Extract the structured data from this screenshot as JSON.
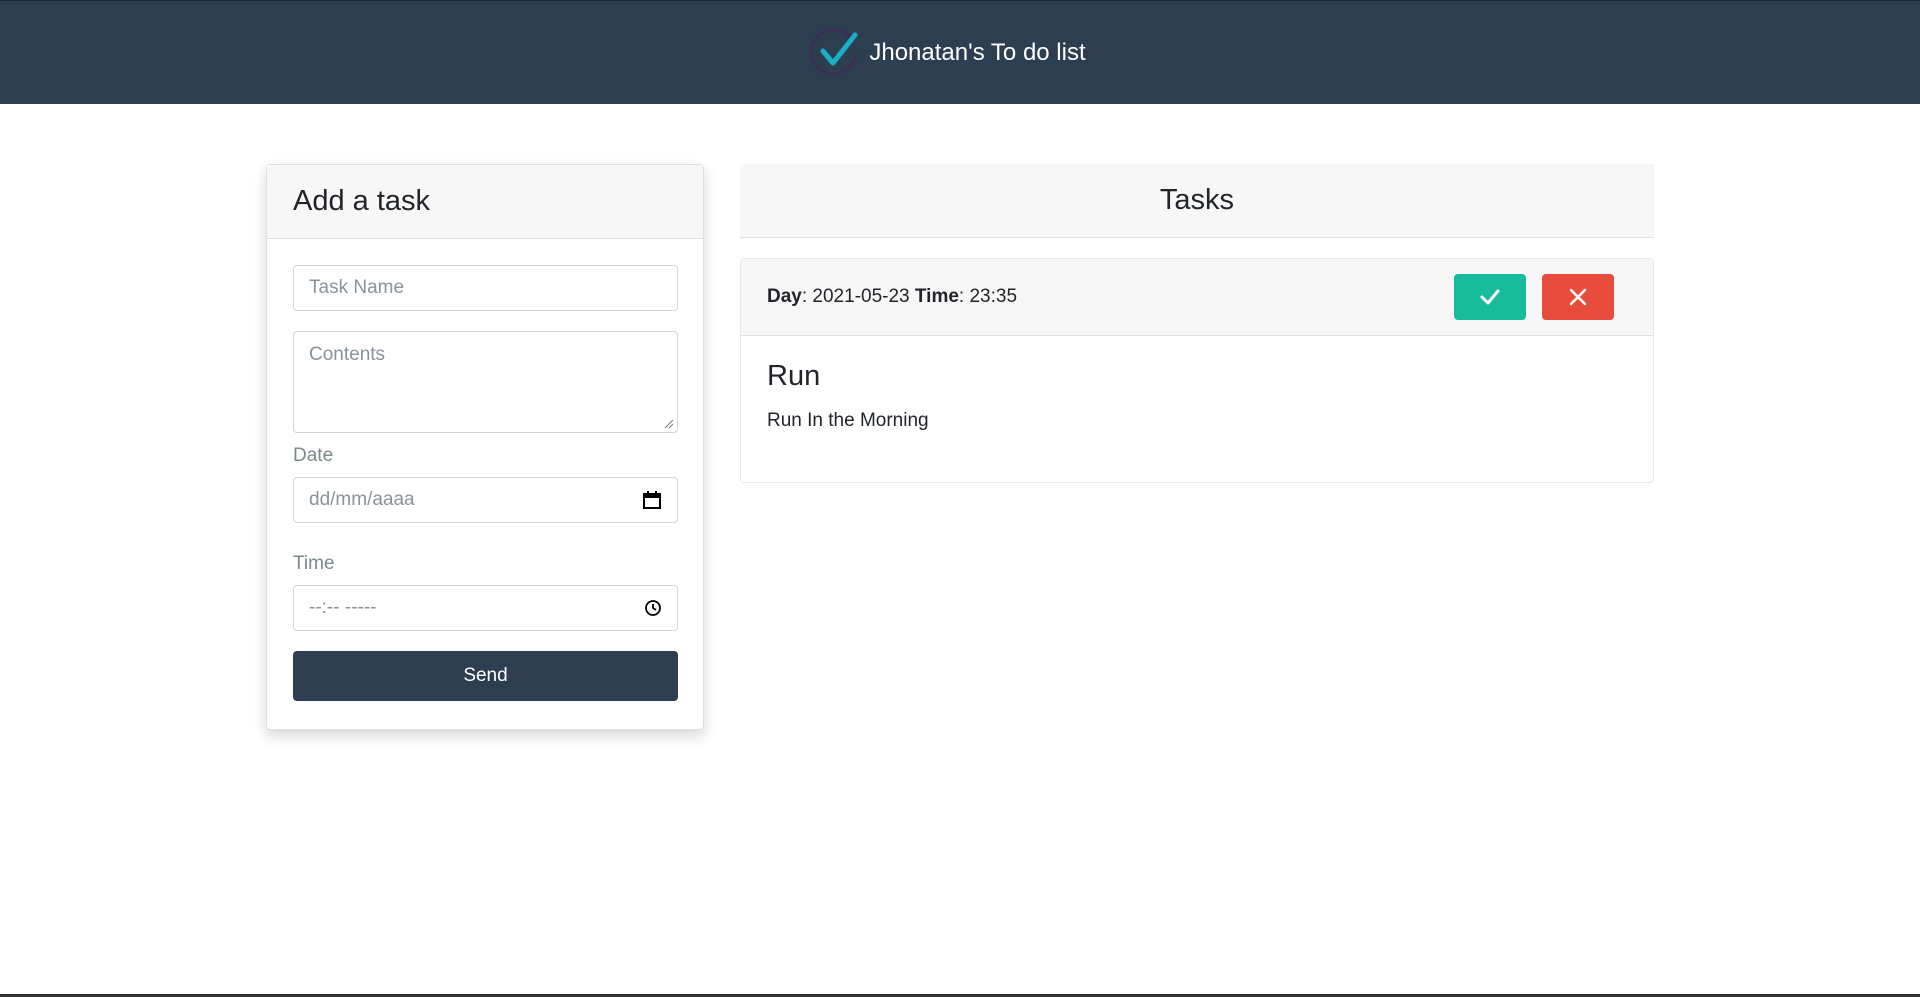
{
  "navbar": {
    "title": "Jhonatan's To do list",
    "logo_icon": "check-circle-icon"
  },
  "add_task": {
    "header": "Add a task",
    "task_name_placeholder": "Task Name",
    "contents_placeholder": "Contents",
    "date_label": "Date",
    "date_placeholder": "dd/mm/aaaa",
    "time_label": "Time",
    "time_placeholder": "--:-- -----",
    "send_label": "Send"
  },
  "tasks": {
    "header": "Tasks",
    "items": [
      {
        "day_label": "Day",
        "day": "2021-05-23",
        "time_label": "Time",
        "time": "23:35",
        "title": "Run",
        "description": "Run In the Morning"
      }
    ]
  },
  "colors": {
    "navbar": "#2c3e50",
    "done": "#18bc9c",
    "delete": "#e74c3c",
    "accent": "#1ab0c9"
  }
}
